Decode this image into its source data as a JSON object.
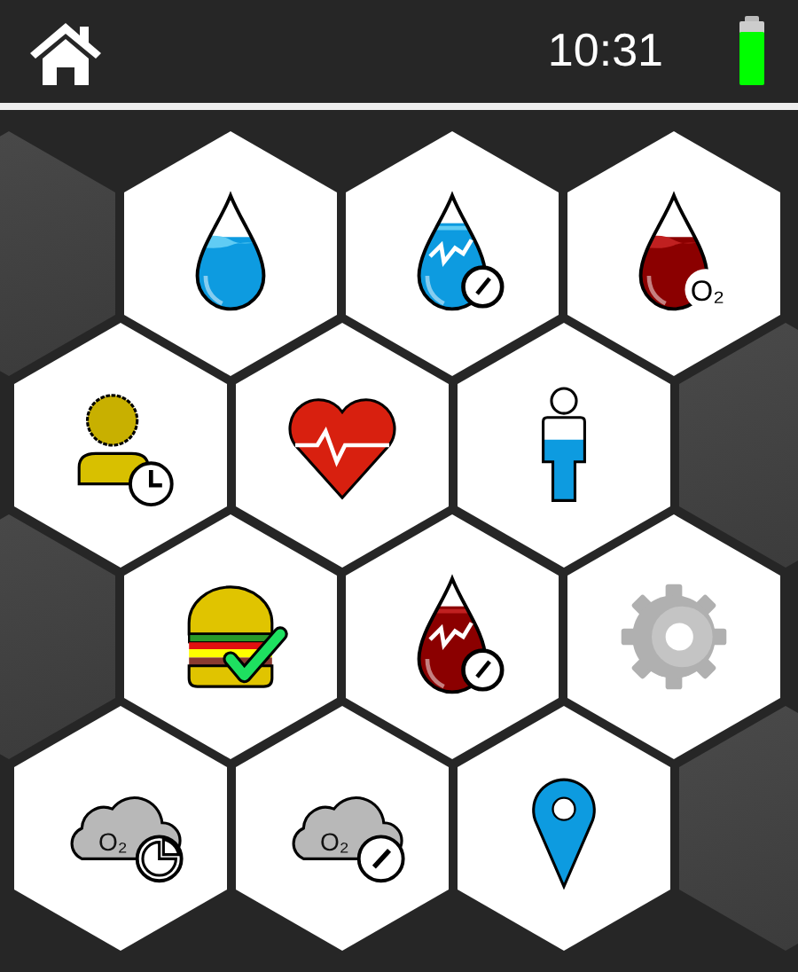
{
  "status_bar": {
    "time": "10:31"
  },
  "rows": [
    [
      {
        "kind": "blank"
      },
      {
        "kind": "water"
      },
      {
        "kind": "water-gauge"
      },
      {
        "kind": "blood-oxygen",
        "text": "O₂"
      }
    ],
    [
      {
        "kind": "person-clock"
      },
      {
        "kind": "heart"
      },
      {
        "kind": "body-water"
      },
      {
        "kind": "blank"
      }
    ],
    [
      {
        "kind": "blank"
      },
      {
        "kind": "burger-check"
      },
      {
        "kind": "blood-gauge"
      },
      {
        "kind": "settings"
      }
    ],
    [
      {
        "kind": "cloud-pie",
        "text": "O₂"
      },
      {
        "kind": "cloud-gauge",
        "text": "O₂"
      },
      {
        "kind": "location"
      },
      {
        "kind": "blank"
      }
    ]
  ]
}
